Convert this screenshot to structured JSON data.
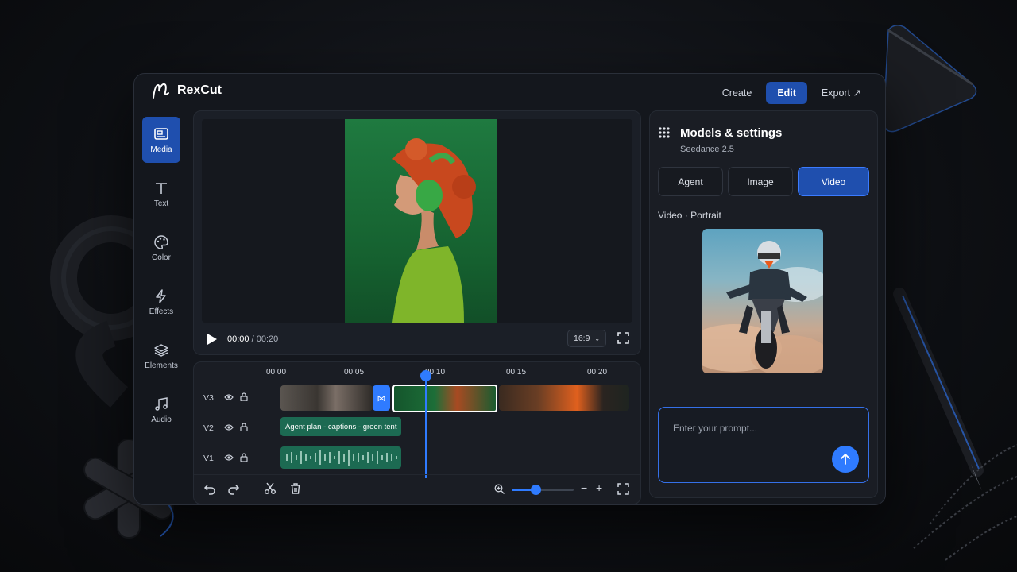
{
  "app": {
    "name": "RexCut",
    "logo_icon": "rexcut-logo-icon"
  },
  "nav": {
    "items": [
      {
        "label": "Create",
        "active": false
      },
      {
        "label": "Edit",
        "active": true
      },
      {
        "label": "Export ↗",
        "active": false
      }
    ]
  },
  "sidebar": {
    "items": [
      {
        "label": "Media",
        "icon": "media-icon",
        "active": true
      },
      {
        "label": "Text",
        "icon": "text-icon",
        "active": false
      },
      {
        "label": "Color",
        "icon": "palette-icon",
        "active": false
      },
      {
        "label": "Effects",
        "icon": "lightning-icon",
        "active": false
      },
      {
        "label": "Elements",
        "icon": "layers-icon",
        "active": false
      },
      {
        "label": "Audio",
        "icon": "music-icon",
        "active": false
      }
    ]
  },
  "player": {
    "current": "00:00",
    "duration": "/ 00:20",
    "aspect": "16:9"
  },
  "timeline": {
    "ticks": [
      "00:00",
      "00:05",
      "00:10",
      "00:15",
      "00:20"
    ],
    "tracks": [
      {
        "label": "V3"
      },
      {
        "label": "V2",
        "clip_text": "Agent plan - captions - green tent"
      },
      {
        "label": "V1"
      }
    ]
  },
  "panel": {
    "title": "Models & settings",
    "subtitle": "Seedance 2.5",
    "tabs": [
      {
        "label": "Agent",
        "active": false
      },
      {
        "label": "Image",
        "active": false
      },
      {
        "label": "Video",
        "active": true
      }
    ],
    "mode_label": "Video · Portrait",
    "prompt_placeholder": "Enter your prompt..."
  },
  "colors": {
    "accent": "#2f7bff",
    "active_bg": "#1f4fae",
    "background": "#14171d"
  }
}
